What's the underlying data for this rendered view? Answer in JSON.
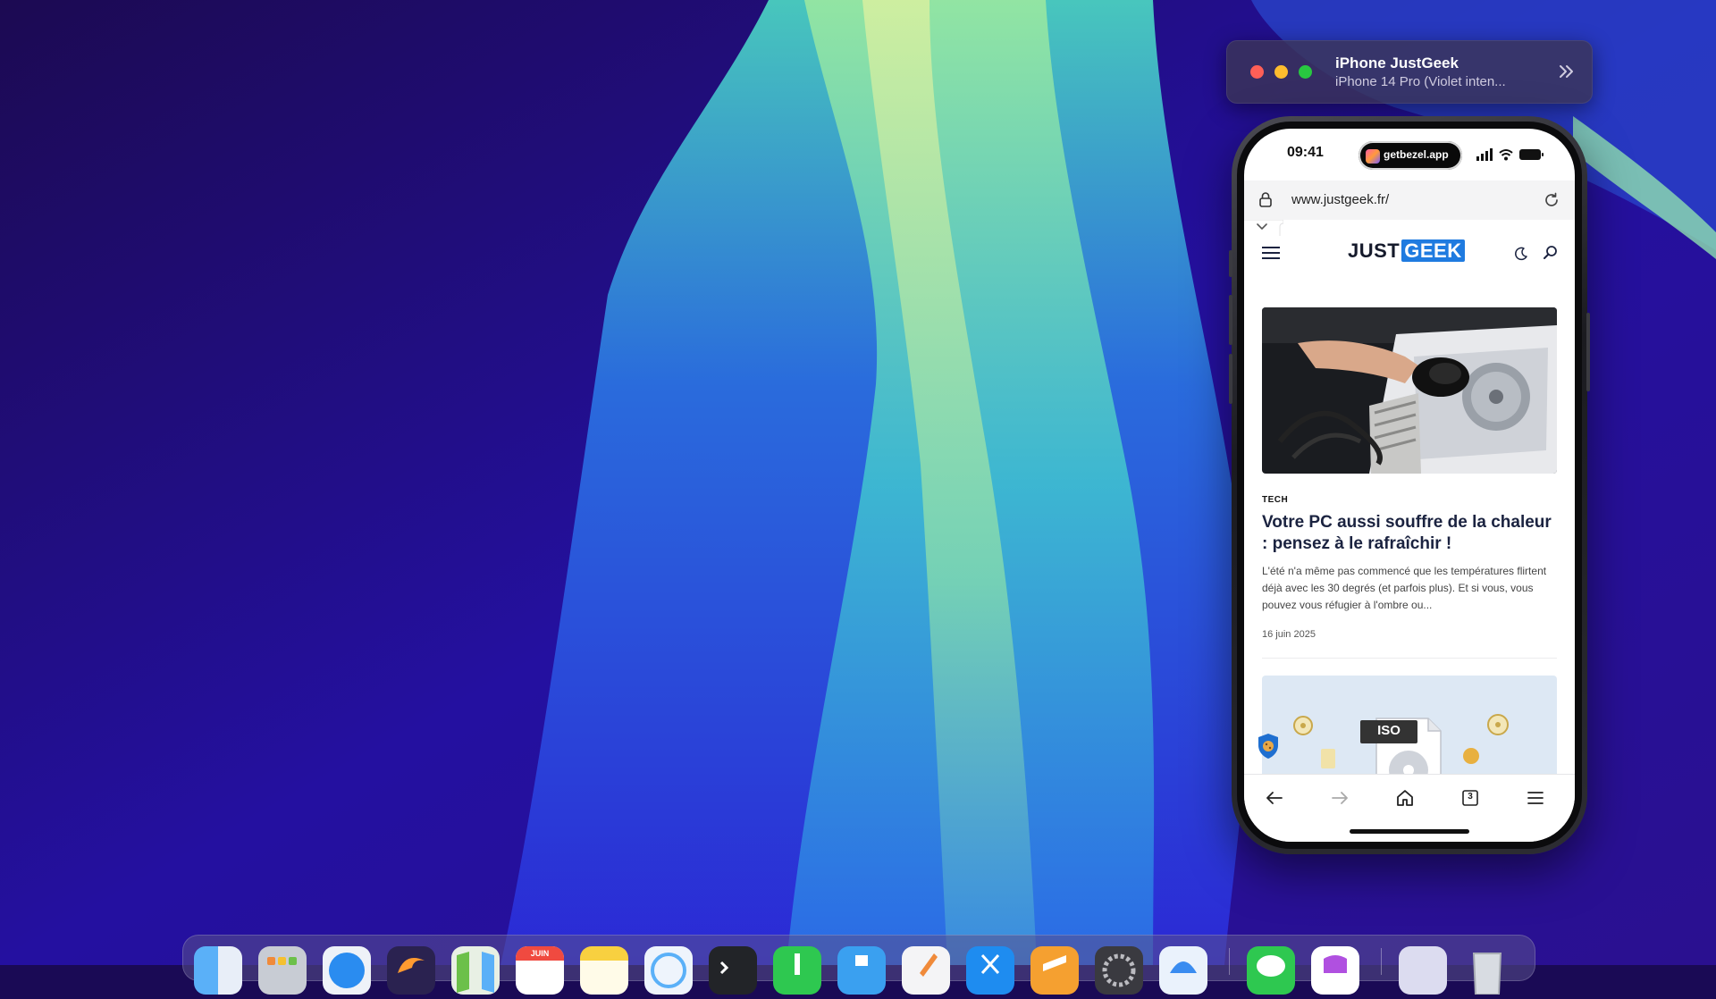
{
  "bezel": {
    "title": "iPhone JustGeek",
    "subtitle": "iPhone 14 Pro (Violet inten..."
  },
  "phone": {
    "status": {
      "time": "09:41",
      "island_label": "getbezel.app"
    },
    "browser": {
      "url": "www.justgeek.fr/",
      "tab_count": "3"
    },
    "site": {
      "logo_part1": "JUST",
      "logo_part2": "GEEK"
    },
    "article": {
      "category": "TECH",
      "title": "Votre PC aussi souffre de la chaleur : pensez à le rafraîchir !",
      "excerpt": "L'été n'a même pas commencé que les températures flirtent déjà avec les 30 degrés (et parfois plus). Et si vous, vous pouvez vous réfugier à l'ombre ou...",
      "date": "16 juin 2025"
    },
    "second_card": {
      "label": "ISO"
    }
  },
  "dock": {
    "calendar_month": "JUIN"
  },
  "colors": {
    "brand_blue": "#1f7be0",
    "red": "#fe5f57",
    "yellow": "#febc2e",
    "green": "#28c840"
  }
}
